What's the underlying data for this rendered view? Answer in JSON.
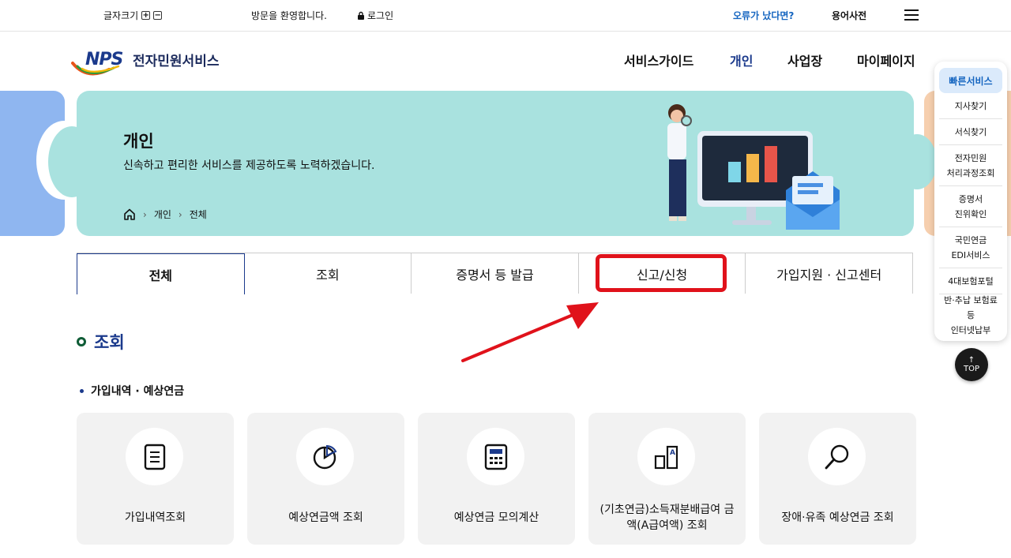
{
  "util": {
    "font_size_label": "글자크기",
    "font_plus": "+",
    "font_minus": "−",
    "welcome": "방문을 환영합니다.",
    "login": "로그인",
    "error_report": "오류가 났다면?",
    "dictionary": "용어사전"
  },
  "header": {
    "logo_text": "NPS",
    "service_name": "전자민원서비스",
    "nav": [
      "서비스가이드",
      "개인",
      "사업장",
      "마이페이지"
    ],
    "active_nav": "개인"
  },
  "banner": {
    "title": "개인",
    "subtitle": "신속하고 편리한 서비스를 제공하도록 노력하겠습니다.",
    "breadcrumb": [
      "개인",
      "전체"
    ]
  },
  "tabs": [
    "전체",
    "조회",
    "증명서 등 발급",
    "신고/신청",
    "가입지원 · 신고센터"
  ],
  "active_tab": "전체",
  "highlighted_tab": "신고/신청",
  "section": {
    "title": "조회",
    "subtitle": "가입내역 · 예상연금",
    "cards": [
      {
        "label": "가입내역조회",
        "icon": "document-icon"
      },
      {
        "label": "예상연금액 조회",
        "icon": "pie-chart-icon"
      },
      {
        "label": "예상연금 모의계산",
        "icon": "calculator-icon"
      },
      {
        "label": "(기초연금)소득재분배급여 금액(A급여액) 조회",
        "icon": "ab-compare-icon"
      },
      {
        "label": "장애·유족 예상연금 조회",
        "icon": "magnifier-icon"
      }
    ]
  },
  "quick": {
    "head": "빠른서비스",
    "items": [
      "지사찾기",
      "서식찾기",
      "전자민원\n처리과정조회",
      "증명서\n진위확인",
      "국민연금\nEDI서비스",
      "4대보험포털",
      "반·추납 보험료등\n인터넷납부"
    ]
  },
  "top_button": "TOP",
  "colors": {
    "brand_navy": "#1b3a8c",
    "banner_bg": "#a9e2df",
    "highlight_red": "#e0121b",
    "link_blue": "#1565c0"
  }
}
